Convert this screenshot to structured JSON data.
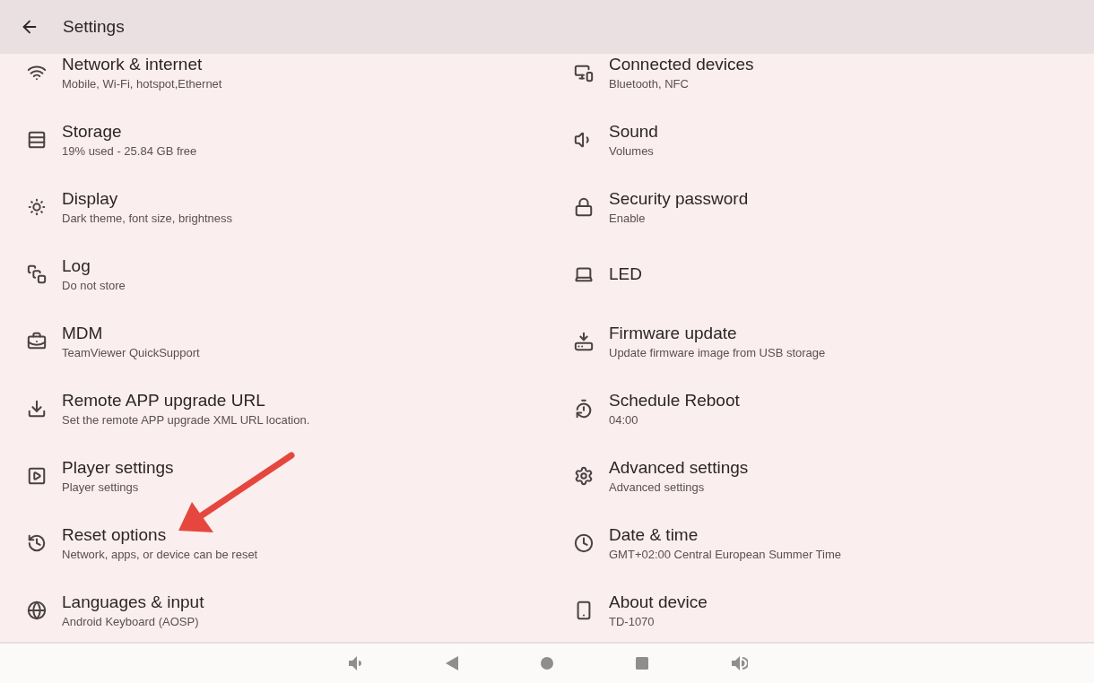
{
  "header": {
    "title": "Settings"
  },
  "columns": [
    [
      {
        "title": "Network & internet",
        "subtitle": "Mobile, Wi-Fi, hotspot,Ethernet"
      },
      {
        "title": "Storage",
        "subtitle": "19% used - 25.84 GB free"
      },
      {
        "title": "Display",
        "subtitle": "Dark theme, font size, brightness"
      },
      {
        "title": "Log",
        "subtitle": "Do not store"
      },
      {
        "title": "MDM",
        "subtitle": "TeamViewer QuickSupport"
      },
      {
        "title": "Remote APP upgrade URL",
        "subtitle": "Set the remote APP upgrade XML URL location."
      },
      {
        "title": "Player settings",
        "subtitle": "Player settings"
      },
      {
        "title": "Reset options",
        "subtitle": "Network, apps, or device can be reset"
      },
      {
        "title": "Languages & input",
        "subtitle": "Android Keyboard (AOSP)"
      }
    ],
    [
      {
        "title": "Connected devices",
        "subtitle": "Bluetooth, NFC"
      },
      {
        "title": "Sound",
        "subtitle": "Volumes"
      },
      {
        "title": "Security password",
        "subtitle": "Enable"
      },
      {
        "title": "LED"
      },
      {
        "title": "Firmware update",
        "subtitle": "Update firmware image from USB storage"
      },
      {
        "title": "Schedule Reboot",
        "subtitle": "04:00"
      },
      {
        "title": "Advanced settings",
        "subtitle": "Advanced settings"
      },
      {
        "title": "Date & time",
        "subtitle": "GMT+02:00 Central European Summer Time"
      },
      {
        "title": "About device",
        "subtitle": "TD-1070"
      }
    ]
  ]
}
